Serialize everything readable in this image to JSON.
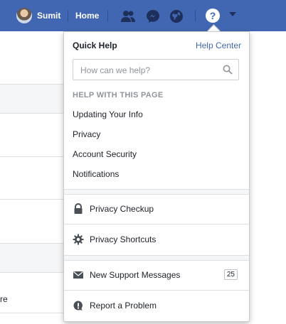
{
  "topbar": {
    "user_name": "Sumit",
    "home_label": "Home",
    "help_glyph": "?",
    "icons": [
      "friend-requests-icon",
      "messenger-icon",
      "notifications-globe-icon",
      "help-icon",
      "caret-down-icon"
    ]
  },
  "background": {
    "partial_text": "re"
  },
  "quick_help": {
    "title": "Quick Help",
    "help_center_label": "Help Center",
    "search_placeholder": "How can we help?",
    "section_heading": "HELP WITH THIS PAGE",
    "links": [
      "Updating Your Info",
      "Privacy",
      "Account Security",
      "Notifications"
    ],
    "items": [
      {
        "label": "Privacy Checkup",
        "icon": "lock-icon"
      },
      {
        "label": "Privacy Shortcuts",
        "icon": "gear-icon"
      },
      {
        "label": "New Support Messages",
        "icon": "envelope-icon",
        "count": "25"
      },
      {
        "label": "Report a Problem",
        "icon": "alert-bubble-icon"
      }
    ]
  },
  "colors": {
    "topbar": "#4267b2",
    "link_blue": "#4267b2"
  }
}
